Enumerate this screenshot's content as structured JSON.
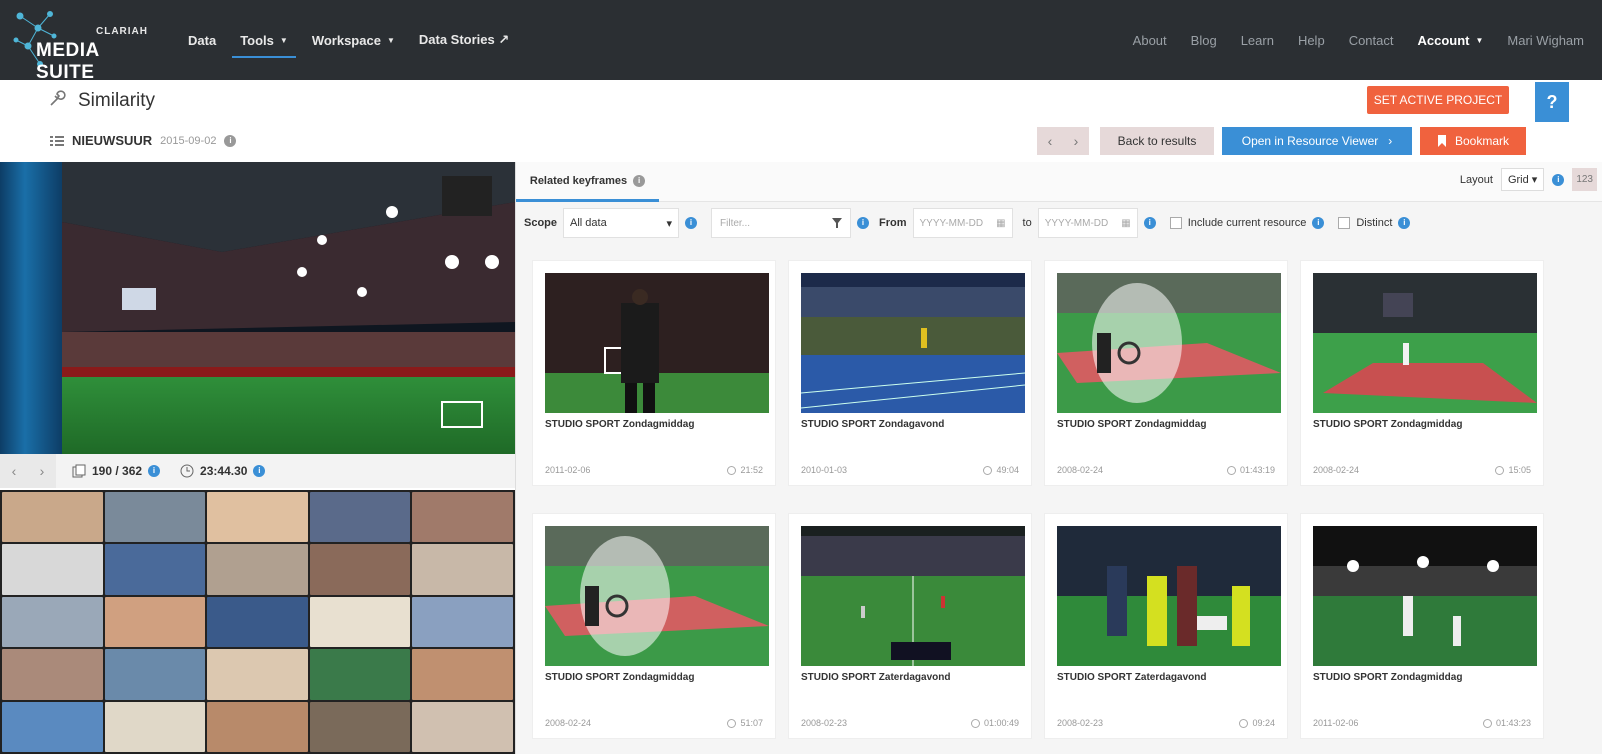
{
  "brand": {
    "small": "CLARIAH",
    "big": "MEDIA SUITE"
  },
  "nav": {
    "left": [
      {
        "label": "Data",
        "caret": false,
        "active": false
      },
      {
        "label": "Tools",
        "caret": true,
        "active": true
      },
      {
        "label": "Workspace",
        "caret": true,
        "active": false
      },
      {
        "label": "Data Stories ↗",
        "caret": false,
        "active": false
      }
    ],
    "right": [
      "About",
      "Blog",
      "Learn",
      "Help",
      "Contact"
    ],
    "account_label": "Account",
    "user_name": "Mari Wigham"
  },
  "page": {
    "title": "Similarity",
    "set_project_label": "SET ACTIVE PROJECT",
    "help_label": "?"
  },
  "resource": {
    "name": "NIEUWSUUR",
    "date": "2015-09-02"
  },
  "actions": {
    "back_label": "Back to results",
    "open_label": "Open in Resource Viewer",
    "bookmark_label": "Bookmark"
  },
  "player": {
    "count": "190 / 362",
    "time": "23:44.30"
  },
  "panel": {
    "tab_label": "Related keyframes",
    "layout_label": "Layout",
    "layout_value": "Grid",
    "count_value": "123"
  },
  "filters": {
    "scope_label": "Scope",
    "scope_value": "All data",
    "filter_placeholder": "Filter...",
    "from_label": "From",
    "from_placeholder": "YYYY-MM-DD",
    "to_label": "to",
    "to_placeholder": "YYYY-MM-DD",
    "include_label": "Include current resource",
    "distinct_label": "Distinct"
  },
  "results": [
    {
      "title": "STUDIO SPORT Zondagmiddag",
      "date": "2011-02-06",
      "duration": "21:52",
      "scene": "soccer-man"
    },
    {
      "title": "STUDIO SPORT Zondagavond",
      "date": "2010-01-03",
      "duration": "49:04",
      "scene": "athletics"
    },
    {
      "title": "STUDIO SPORT Zondagmiddag",
      "date": "2008-02-24",
      "duration": "01:43:19",
      "scene": "tennis-fog"
    },
    {
      "title": "STUDIO SPORT Zondagmiddag",
      "date": "2008-02-24",
      "duration": "15:05",
      "scene": "tennis-court"
    },
    {
      "title": "STUDIO SPORT Zondagmiddag",
      "date": "2008-02-24",
      "duration": "51:07",
      "scene": "tennis-fog"
    },
    {
      "title": "STUDIO SPORT Zaterdagavond",
      "date": "2008-02-23",
      "duration": "01:00:49",
      "scene": "rugby"
    },
    {
      "title": "STUDIO SPORT Zaterdagavond",
      "date": "2008-02-23",
      "duration": "09:24",
      "scene": "medics"
    },
    {
      "title": "STUDIO SPORT Zondagmiddag",
      "date": "2011-02-06",
      "duration": "01:43:23",
      "scene": "stadium-night"
    }
  ],
  "colors": {
    "accent_blue": "#3a8fd6",
    "accent_orange": "#f0623e",
    "nav_bg": "#2b2f33"
  }
}
